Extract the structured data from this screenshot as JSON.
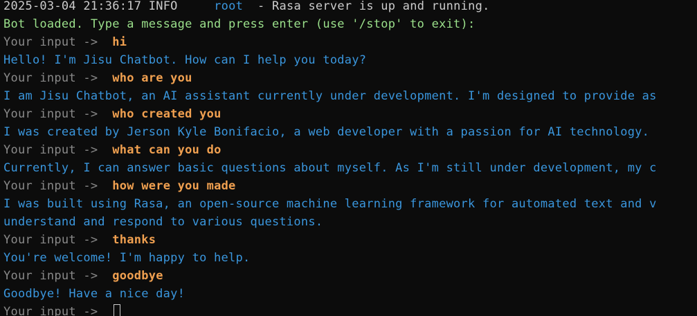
{
  "colors": {
    "background": "#0c0c0c",
    "log_text": "#cccccc",
    "logger_name": "#3a96dd",
    "loaded_text": "#9be08b",
    "prompt": "#8a8a8a",
    "user_input": "#f0a050",
    "bot_reply": "#3a96dd"
  },
  "log": {
    "timestamp": "2025-03-04 21:36:17",
    "level": "INFO",
    "logger": "root",
    "message": "- Rasa server is up and running."
  },
  "loaded_message": "Bot loaded. Type a message and press enter (use '/stop' to exit):",
  "prompt": "Your input ->",
  "exchanges": [
    {
      "user": "hi",
      "bot": [
        "Hello! I'm Jisu Chatbot. How can I help you today?"
      ]
    },
    {
      "user": "who are you",
      "bot": [
        "I am Jisu Chatbot, an AI assistant currently under development. I'm designed to provide as"
      ]
    },
    {
      "user": "who created you",
      "bot": [
        "I was created by Jerson Kyle Bonifacio, a web developer with a passion for AI technology."
      ]
    },
    {
      "user": "what can you do",
      "bot": [
        "Currently, I can answer basic questions about myself. As I'm still under development, my c"
      ]
    },
    {
      "user": "how were you made",
      "bot": [
        "I was built using Rasa, an open-source machine learning framework for automated text and v",
        "understand and respond to various questions."
      ]
    },
    {
      "user": "thanks",
      "bot": [
        "You're welcome! I'm happy to help."
      ]
    },
    {
      "user": "goodbye",
      "bot": [
        "Goodbye! Have a nice day!"
      ]
    }
  ]
}
